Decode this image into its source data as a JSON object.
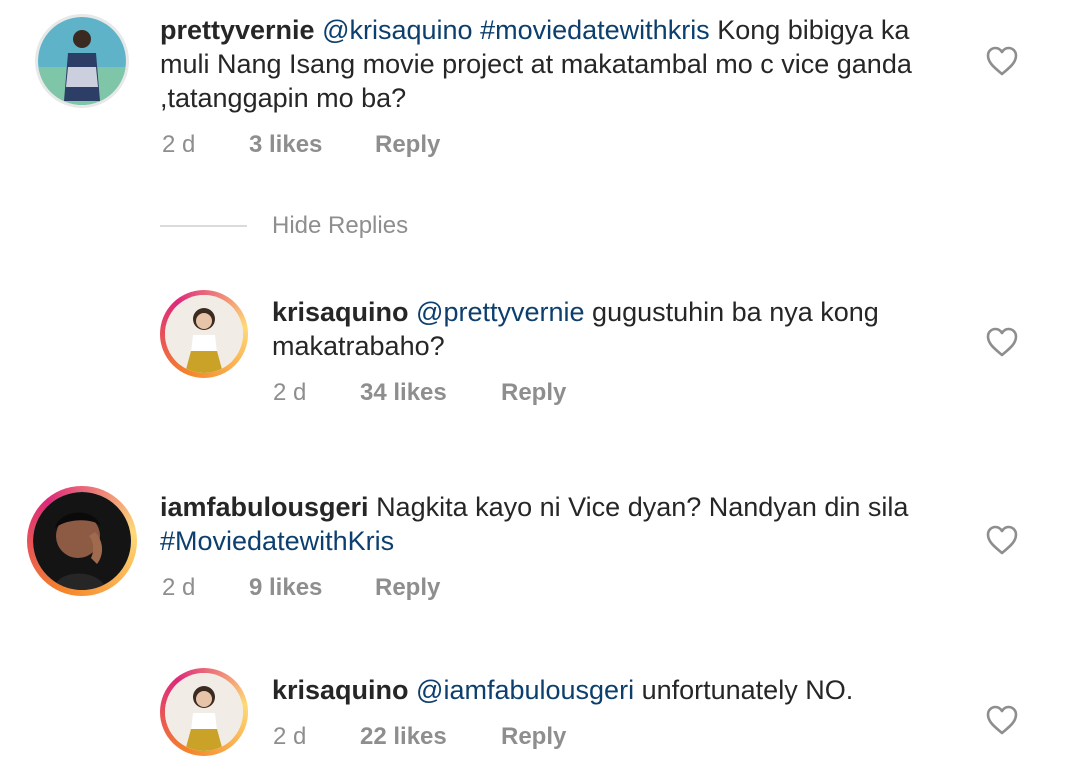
{
  "comments": [
    {
      "username": "prettyvernie",
      "mention": "@krisaquino",
      "hashtag": "#moviedatewithkris",
      "body": "Kong bibigya ka muli Nang Isang  movie project at makatambal mo c vice ganda ,tatanggapin mo ba?",
      "time": "2 d",
      "likes": "3 likes",
      "reply": "Reply"
    },
    {
      "username": "krisaquino",
      "mention": "@prettyvernie",
      "body": "gugustuhin ba nya kong makatrabaho?",
      "time": "2 d",
      "likes": "34 likes",
      "reply": "Reply"
    },
    {
      "username": "iamfabulousgeri",
      "body": "Nagkita kayo ni Vice dyan? Nandyan din sila",
      "hashtag": "#MoviedatewithKris",
      "time": "2 d",
      "likes": "9 likes",
      "reply": "Reply"
    },
    {
      "username": "krisaquino",
      "mention": "@iamfabulousgeri",
      "body": "unfortunately NO.",
      "time": "2 d",
      "likes": "22 likes",
      "reply": "Reply"
    }
  ],
  "hide_replies_label": "Hide Replies",
  "icons": {
    "like": "heart-outline-icon"
  },
  "colors": {
    "link": "#0c3f6e",
    "muted": "#8e8e8e",
    "text": "#262626"
  }
}
